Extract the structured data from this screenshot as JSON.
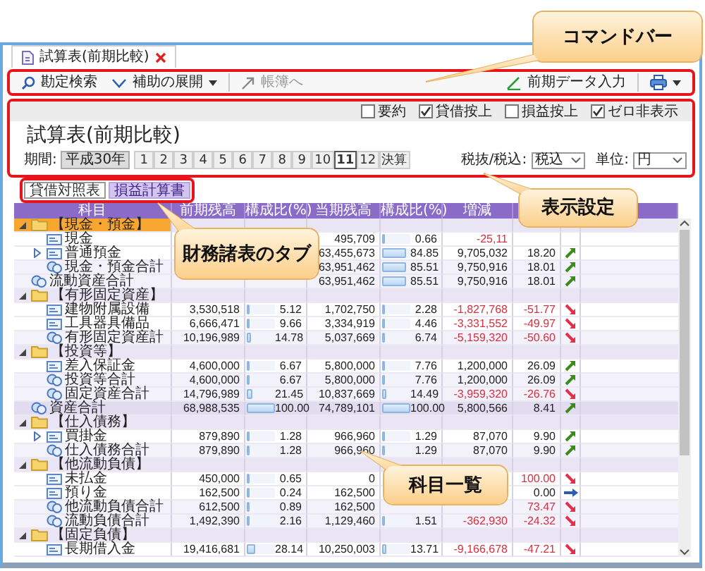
{
  "tab": {
    "title": "試算表(前期比較)"
  },
  "command_bar": {
    "left": [
      {
        "kind": "search",
        "label": "勘定検索",
        "disabled": false,
        "dropdown": false
      },
      {
        "kind": "expand",
        "label": "補助の展開",
        "disabled": false,
        "dropdown": true
      },
      {
        "kind": "jump",
        "label": "帳簿へ",
        "disabled": true,
        "dropdown": false
      }
    ],
    "right": [
      {
        "kind": "entry",
        "label": "前期データ入力",
        "disabled": false,
        "dropdown": false
      }
    ]
  },
  "settings": {
    "options": [
      {
        "label": "要約",
        "checked": false
      },
      {
        "label": "貸借按上",
        "checked": true
      },
      {
        "label": "損益按上",
        "checked": false
      },
      {
        "label": "ゼロ非表示",
        "checked": true
      }
    ],
    "title": "試算表(前期比較)",
    "period_label": "期間:",
    "era": "平成30年",
    "periods": [
      {
        "label": "1",
        "selected": false
      },
      {
        "label": "2",
        "selected": false
      },
      {
        "label": "3",
        "selected": false
      },
      {
        "label": "4",
        "selected": false
      },
      {
        "label": "5",
        "selected": false
      },
      {
        "label": "6",
        "selected": false
      },
      {
        "label": "7",
        "selected": false
      },
      {
        "label": "8",
        "selected": false
      },
      {
        "label": "9",
        "selected": false
      },
      {
        "label": "10",
        "selected": false
      },
      {
        "label": "11",
        "selected": true
      },
      {
        "label": "12",
        "selected": false
      },
      {
        "label": "決算",
        "selected": false
      }
    ],
    "tax": {
      "label": "税抜/税込:",
      "value": "税込"
    },
    "unit": {
      "label": "単位:",
      "value": "円"
    }
  },
  "report_tabs": [
    {
      "label": "貸借対照表",
      "selected": true
    },
    {
      "label": "損益計算書",
      "selected": false
    }
  ],
  "table": {
    "columns": [
      "科目",
      "前期残高",
      "構成比(%)",
      "当期残高",
      "構成比(%)",
      "増減"
    ],
    "rows": [
      {
        "kind": "group",
        "name": "【現金・預金】",
        "expanded": true,
        "selected": true,
        "children": [
          {
            "kind": "account",
            "name": "現金",
            "selected": false,
            "cur": {
              "amount": "495,709",
              "ratio": "0.66",
              "level": 0.0066
            },
            "diff": "-25,11",
            "negative": true
          },
          {
            "kind": "account",
            "name": "普通預金",
            "expanded": false,
            "selected": false,
            "cur": {
              "amount": "63,455,673",
              "ratio": "84.85",
              "level": 0.8485
            },
            "diff": "9,705,032",
            "rate": "18.20",
            "negative": false,
            "change_icon": {
              "kind": "up"
            }
          },
          {
            "kind": "subtotal",
            "name": "現金・預金合計",
            "selected": false,
            "cur": {
              "amount": "63,951,462",
              "ratio": "85.51",
              "level": 0.8551
            },
            "diff": "9,750,916",
            "rate": "18.01",
            "negative": false,
            "change_icon": {
              "kind": "up"
            }
          }
        ]
      },
      {
        "kind": "subtotal",
        "name": "流動資産合計",
        "selected": false,
        "cur": {
          "amount": "63,951,462",
          "ratio": "85.51",
          "level": 0.8551
        },
        "diff": "9,750,916",
        "rate": "18.01",
        "negative": false,
        "change_icon": {
          "kind": "up"
        }
      },
      {
        "kind": "group",
        "name": "【有形固定資産】",
        "expanded": true,
        "selected": false,
        "children": [
          {
            "kind": "account",
            "name": "建物附属設備",
            "selected": false,
            "prev": {
              "amount": "3,530,518",
              "ratio": "5.12",
              "level": 0.0512
            },
            "cur": {
              "amount": "1,702,750",
              "ratio": "2.28",
              "level": 0.0228
            },
            "diff": "-1,827,768",
            "rate": "-51.77",
            "negative": true,
            "change_icon": {
              "kind": "down"
            }
          },
          {
            "kind": "account",
            "name": "工具器具備品",
            "selected": false,
            "prev": {
              "amount": "6,666,471",
              "ratio": "9.66",
              "level": 0.0966
            },
            "cur": {
              "amount": "3,334,919",
              "ratio": "4.46",
              "level": 0.0446
            },
            "diff": "-3,331,552",
            "rate": "-49.97",
            "negative": true,
            "change_icon": {
              "kind": "down"
            }
          },
          {
            "kind": "subtotal",
            "name": "有形固定資産計",
            "selected": false,
            "prev": {
              "amount": "10,196,989",
              "ratio": "14.78",
              "level": 0.1478
            },
            "cur": {
              "amount": "5,037,669",
              "ratio": "6.74",
              "level": 0.0674
            },
            "diff": "-5,159,320",
            "rate": "-50.60",
            "negative": true,
            "change_icon": {
              "kind": "down"
            }
          }
        ]
      },
      {
        "kind": "group",
        "name": "【投資等】",
        "expanded": true,
        "selected": false,
        "children": [
          {
            "kind": "account",
            "name": "差入保証金",
            "selected": false,
            "prev": {
              "amount": "4,600,000",
              "ratio": "6.67",
              "level": 0.0667
            },
            "cur": {
              "amount": "5,800,000",
              "ratio": "7.76",
              "level": 0.0776
            },
            "diff": "1,200,000",
            "rate": "26.09",
            "negative": false,
            "change_icon": {
              "kind": "up"
            }
          },
          {
            "kind": "subtotal",
            "name": "投資等合計",
            "selected": false,
            "prev": {
              "amount": "4,600,000",
              "ratio": "6.67",
              "level": 0.0667
            },
            "cur": {
              "amount": "5,800,000",
              "ratio": "7.76",
              "level": 0.0776
            },
            "diff": "1,200,000",
            "rate": "26.09",
            "negative": false,
            "change_icon": {
              "kind": "up"
            }
          },
          {
            "kind": "subtotal",
            "name": "固定資産合計",
            "selected": false,
            "prev": {
              "amount": "14,796,989",
              "ratio": "21.45",
              "level": 0.2145
            },
            "cur": {
              "amount": "10,837,669",
              "ratio": "14.49",
              "level": 0.1449
            },
            "diff": "-3,959,320",
            "rate": "-26.76",
            "negative": true,
            "change_icon": {
              "kind": "down"
            }
          }
        ]
      },
      {
        "kind": "total",
        "name": "資産合計",
        "selected": false,
        "prev": {
          "amount": "68,988,535",
          "ratio": "100.00",
          "level": 1
        },
        "cur": {
          "amount": "74,789,101",
          "ratio": "100.00",
          "level": 1
        },
        "diff": "5,800,566",
        "rate": "8.41",
        "negative": false,
        "change_icon": {
          "kind": "up"
        }
      },
      {
        "kind": "group",
        "name": "【仕入債務】",
        "expanded": true,
        "selected": false,
        "children": [
          {
            "kind": "account",
            "name": "買掛金",
            "expanded": false,
            "selected": false,
            "prev": {
              "amount": "879,890",
              "ratio": "1.28",
              "level": 0.0128
            },
            "cur": {
              "amount": "966,960",
              "ratio": "1.29",
              "level": 0.0129
            },
            "diff": "87,070",
            "rate": "9.90",
            "negative": false,
            "change_icon": {
              "kind": "up"
            }
          },
          {
            "kind": "subtotal",
            "name": "仕入債務合計",
            "selected": false,
            "prev": {
              "amount": "879,890",
              "ratio": "1.28",
              "level": 0.0128
            },
            "cur": {
              "amount": "966,960",
              "ratio": "1.29",
              "level": 0.0129
            },
            "diff": "87,070",
            "rate": "9.90",
            "negative": false,
            "change_icon": {
              "kind": "up"
            }
          }
        ]
      },
      {
        "kind": "group",
        "name": "【他流動負債】",
        "expanded": true,
        "selected": false,
        "children": [
          {
            "kind": "account",
            "name": "未払金",
            "selected": false,
            "prev": {
              "amount": "450,000",
              "ratio": "0.65",
              "level": 0.0065
            },
            "cur": {
              "amount": "0"
            },
            "rate": "100.00",
            "negative": true,
            "change_icon": {
              "kind": "down"
            }
          },
          {
            "kind": "account",
            "name": "預り金",
            "selected": false,
            "prev": {
              "amount": "162,500",
              "ratio": "0.24",
              "level": 0.0024
            },
            "cur": {
              "amount": "162,500"
            },
            "rate": "0.00",
            "negative": false,
            "change_icon": {
              "kind": "flat"
            }
          },
          {
            "kind": "subtotal",
            "name": "他流動負債合計",
            "selected": false,
            "prev": {
              "amount": "612,500",
              "ratio": "0.89",
              "level": 0.0089
            },
            "cur": {
              "amount": "162,500"
            },
            "rate": "73.47",
            "negative": true,
            "change_icon": {
              "kind": "down"
            }
          },
          {
            "kind": "subtotal",
            "name": "流動負債合計",
            "selected": false,
            "prev": {
              "amount": "1,492,390",
              "ratio": "2.16",
              "level": 0.0216
            },
            "cur": {
              "amount": "1,129,460",
              "ratio": "1.51",
              "level": 0.0151
            },
            "diff": "-362,930",
            "rate": "-24.32",
            "negative": true,
            "change_icon": {
              "kind": "down"
            }
          }
        ]
      },
      {
        "kind": "group",
        "name": "【固定負債】",
        "expanded": true,
        "selected": false,
        "children": [
          {
            "kind": "account",
            "name": "長期借入金",
            "selected": false,
            "prev": {
              "amount": "19,416,681",
              "ratio": "28.14",
              "level": 0.2814
            },
            "cur": {
              "amount": "10,250,003",
              "ratio": "13.71",
              "level": 0.1371
            },
            "diff": "-9,166,678",
            "rate": "-47.21",
            "negative": true,
            "change_icon": {
              "kind": "down"
            }
          }
        ]
      }
    ]
  },
  "callouts": [
    {
      "text": "コマンドバー"
    },
    {
      "text": "表示設定"
    },
    {
      "text": "財務諸表のタブ"
    },
    {
      "text": "科目一覧"
    }
  ]
}
